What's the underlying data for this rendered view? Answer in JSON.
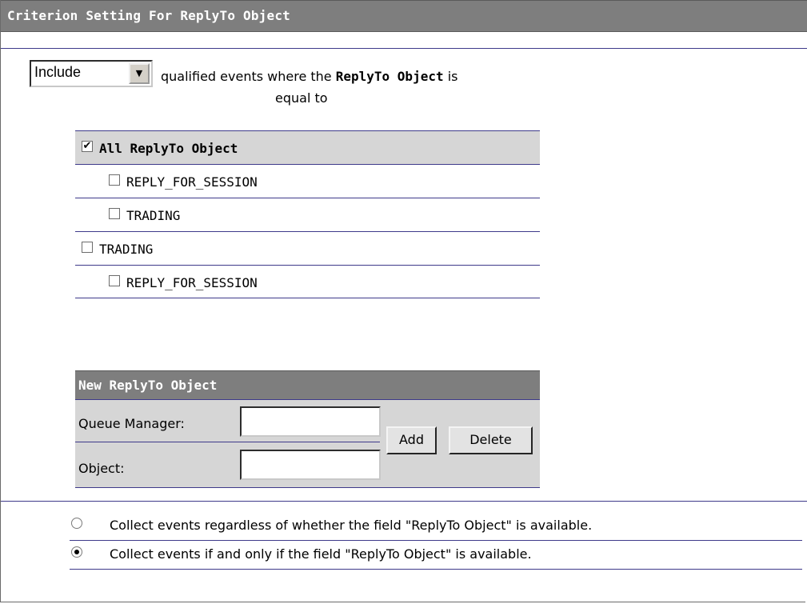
{
  "header": {
    "title": "Criterion Setting For ReplyTo Object"
  },
  "filter": {
    "mode_value": "Include",
    "text_pre": "qualified events where the",
    "text_bold": "ReplyTo Object",
    "text_post": "is",
    "text_line2": "equal to"
  },
  "tree": {
    "rows": [
      {
        "label": "All ReplyTo Object",
        "checked": true
      },
      {
        "label": "REPLY_FOR_SESSION",
        "checked": false
      },
      {
        "label": "TRADING",
        "checked": false
      },
      {
        "label": "TRADING",
        "checked": false
      },
      {
        "label": "REPLY_FOR_SESSION",
        "checked": false
      }
    ]
  },
  "new_object": {
    "title": "New ReplyTo Object",
    "queue_manager_label": "Queue Manager:",
    "queue_manager_value": "",
    "object_label": "Object:",
    "object_value": "",
    "add_label": "Add",
    "delete_label": "Delete"
  },
  "collect": {
    "options": [
      {
        "label": "Collect events regardless of whether the field \"ReplyTo Object\" is available.",
        "selected": false
      },
      {
        "label": "Collect events if and only if the field \"ReplyTo Object\" is available.",
        "selected": true
      }
    ]
  }
}
